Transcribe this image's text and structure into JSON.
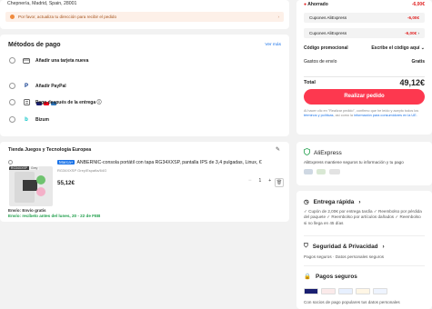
{
  "address": {
    "line": "Chepnería, Madrid, Spain, 28001",
    "warning": "Por favor, actualiza tu dirección para recibir el pedido"
  },
  "payment": {
    "title": "Métodos de pago",
    "see_all": "Ver más",
    "methods": [
      {
        "label": "Añadir una tarjeta nueva",
        "icon": "credit-card-icon"
      },
      {
        "label": "Añadir PayPal",
        "icon": "paypal-icon"
      },
      {
        "label": "Pago después de la entrega ⓘ",
        "icon": "pay-later-icon"
      },
      {
        "label": "Bizum",
        "icon": "bizum-icon"
      }
    ]
  },
  "store": {
    "name": "Tienda Juegos y Tecnología Europea",
    "badge": "Marca+",
    "product": "ANBERNIC-consola portátil con tapa RG34XXSP, pantalla IPS de 3,4 pulgadas, Linux, €",
    "variant": "RG34XXSP Grey/España/64G",
    "thumb_tag": "RG34XXSP",
    "thumb_tag2": "Grey",
    "price": "55,12€",
    "qty_minus": "−",
    "qty": "1",
    "qty_plus": "+",
    "shipping_line1": "Envío: Envío gratis",
    "shipping_line2": "Envío: recíbelo antes del lunes, 20 - 22 de FEB"
  },
  "summary": {
    "saved_label": "Ahorrado",
    "saved_value": "-6,00€",
    "coupon1_label": "Cupones AliExpress",
    "coupon1_value": "-6,00€",
    "coupon2_label": "Cupones AliExpress",
    "coupon2_value": "-6,00€",
    "promo_label": "Código promocional",
    "promo_value": "Escribe el código aquí",
    "shipping_label": "Gastos de envío",
    "shipping_value": "Gratis",
    "total_label": "Total",
    "total_value": "49,12€",
    "button": "Realizar pedido",
    "legal_a": "Al hacer clic en \"Realizar pedido\", confirmo que he leído y acepto todos los",
    "legal_link": "términos y políticas",
    "legal_b": ", así como la",
    "legal_link2": "información para consumidores en la UE."
  },
  "protection": {
    "title": "AliExpress",
    "desc": "AliExpress mantiene seguros tu información y tu pago"
  },
  "info": {
    "delivery_title": "Entrega rápida",
    "delivery_text": "✓ Cupón de 2,00€ por entrega tardía  ✓ Reembolso por pérdida del paquete  ✓ Reembolso por artículos dañados  ✓ Reembolso si no llega en 45 días",
    "security_title": "Seguridad & Privacidad",
    "security_text": "Pagos seguros · Datos personales seguros",
    "payments_title": "Pagos seguros",
    "payments_text": "Con socios de pago populares tus datos personales"
  },
  "colors": {
    "accent": "#fd384f",
    "link": "#1a73e8",
    "success": "#1e9e4a"
  }
}
